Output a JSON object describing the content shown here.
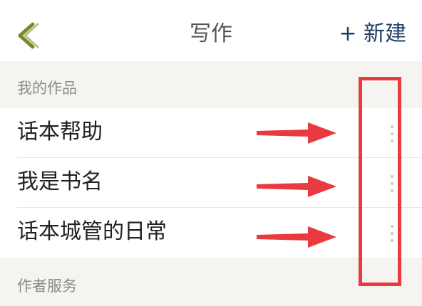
{
  "nav": {
    "back_icon": "chevron-left-icon",
    "title": "写作",
    "new_label": "+ 新建",
    "accent_color": "#7a8a2a",
    "new_color": "#1f3f66"
  },
  "sections": {
    "my_works": "我的作品",
    "author_services": "作者服务"
  },
  "works": [
    {
      "title": "话本帮助",
      "more_icon": "more-vertical-icon"
    },
    {
      "title": "我是书名",
      "more_icon": "more-vertical-icon"
    },
    {
      "title": "话本城管的日常",
      "more_icon": "more-vertical-icon"
    }
  ],
  "annotations": {
    "arrow_color": "#e83a3f",
    "box_color": "#e83a3f"
  }
}
